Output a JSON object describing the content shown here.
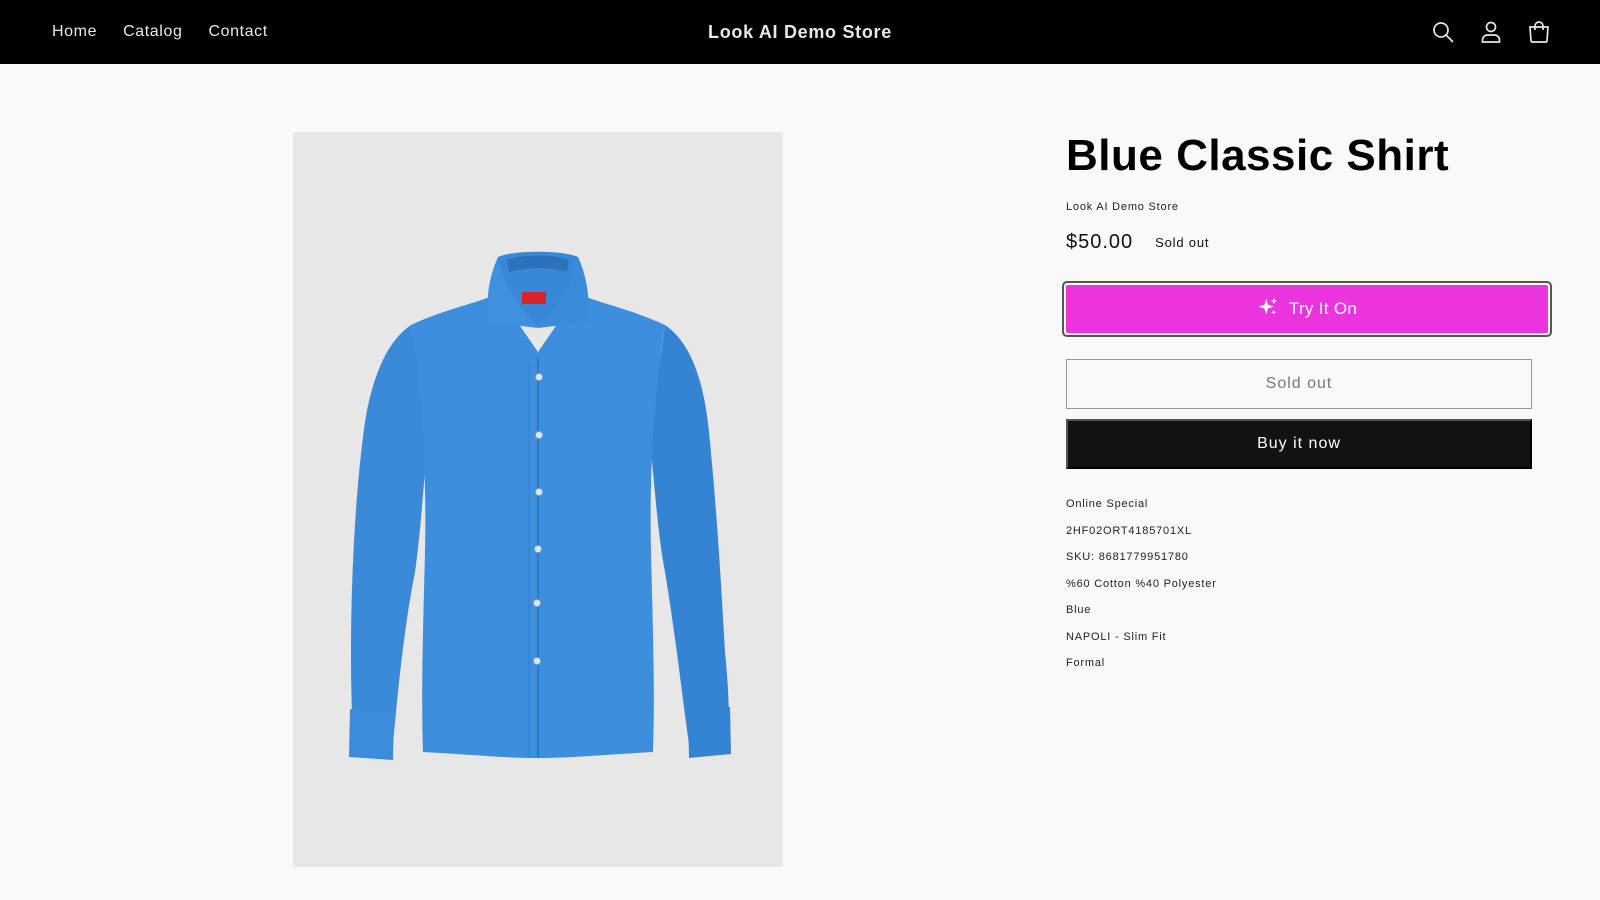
{
  "header": {
    "nav": [
      {
        "label": "Home"
      },
      {
        "label": "Catalog"
      },
      {
        "label": "Contact"
      }
    ],
    "store_name": "Look AI Demo Store",
    "icons": [
      "search-icon",
      "account-icon",
      "cart-icon"
    ]
  },
  "product": {
    "image_icon": "blue-shirt-image",
    "title": "Blue Classic Shirt",
    "vendor": "Look AI Demo Store",
    "price": "$50.00",
    "badge": "Sold out",
    "try_on_label": "Try It On",
    "try_on_icon": "sparkle-icon",
    "add_to_cart_label": "Sold out",
    "buy_now_label": "Buy it now",
    "description": [
      "Online Special",
      "2HF02ORT4185701XL",
      "SKU: 8681779951780",
      "%60 Cotton %40 Polyester",
      "Blue",
      "NAPOLI - Slim Fit",
      "Formal"
    ]
  },
  "colors": {
    "header_bg": "#000000",
    "page_bg": "#f9f9f9",
    "try_on_bg": "#ea34de",
    "buy_now_bg": "#121212",
    "shirt": "#3b8fde"
  }
}
